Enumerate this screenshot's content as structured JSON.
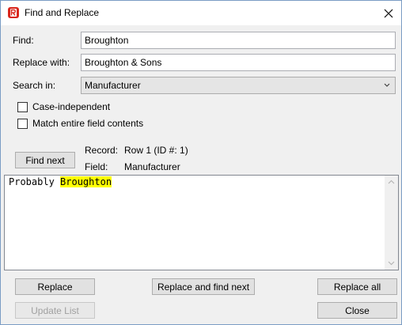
{
  "window": {
    "title": "Find and Replace",
    "app_icon": "app-logo-icon",
    "close_icon": "close-icon"
  },
  "find": {
    "label": "Find:",
    "value": "Broughton"
  },
  "replace": {
    "label": "Replace with:",
    "value": "Broughton & Sons"
  },
  "search_in": {
    "label": "Search in:",
    "selected": "Manufacturer"
  },
  "options": {
    "case_independent": "Case-independent",
    "match_entire": "Match entire field contents"
  },
  "find_next_label": "Find next",
  "record": {
    "record_label": "Record:",
    "record_value": "Row 1 (ID #: 1)",
    "field_label": "Field:",
    "field_value": "Manufacturer"
  },
  "preview": {
    "before": "Probably ",
    "match": "Broughton"
  },
  "buttons": {
    "replace": "Replace",
    "replace_find_next": "Replace and find next",
    "replace_all": "Replace all",
    "update_list": "Update List",
    "close": "Close"
  },
  "colors": {
    "highlight": "#ffff00",
    "accent": "#0078d7"
  }
}
